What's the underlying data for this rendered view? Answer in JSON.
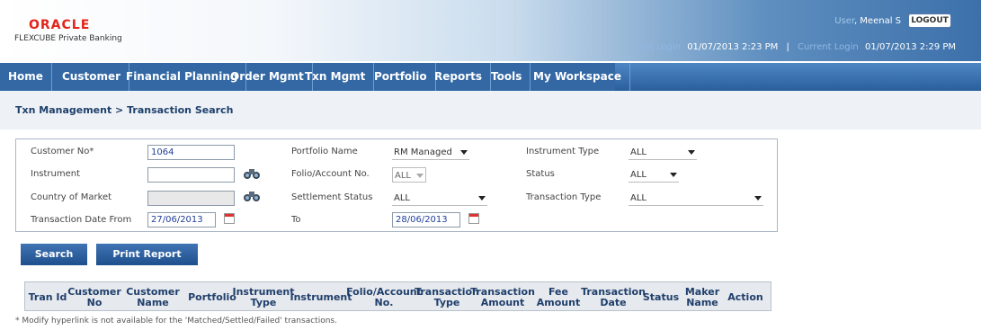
{
  "header": {
    "logo": "ORACLE",
    "product": "FLEXCUBE Private Banking",
    "user_label": "User",
    "user_name": ", Meenal S",
    "logout": "LOGOUT",
    "last_login_label": "Last Login",
    "last_login_value": "01/07/2013 2:23 PM",
    "current_login_label": "Current Login",
    "current_login_value": "01/07/2013 2:29 PM",
    "separator": "|"
  },
  "nav": [
    "Home",
    "Customer",
    "Financial Planning",
    "Order Mgmt",
    "Txn Mgmt",
    "Portfolio",
    "Reports",
    "Tools",
    "My Workspace"
  ],
  "breadcrumb": "Txn Management > Transaction Search",
  "form": {
    "customer_no_label": "Customer No*",
    "customer_no_value": "1064",
    "instrument_label": "Instrument",
    "instrument_value": "",
    "country_label": "Country of Market",
    "country_value": "",
    "date_from_label": "Transaction Date From",
    "date_from_value": "27/06/2013",
    "portfolio_name_label": "Portfolio Name",
    "portfolio_name_value": "RM Managed",
    "folio_label": "Folio/Account No.",
    "folio_value": "ALL",
    "settlement_label": "Settlement Status",
    "settlement_value": "ALL",
    "to_label": "To",
    "to_value": "28/06/2013",
    "instrument_type_label": "Instrument Type",
    "instrument_type_value": "ALL",
    "status_label": "Status",
    "status_value": "ALL",
    "txn_type_label": "Transaction Type",
    "txn_type_value": "ALL"
  },
  "buttons": {
    "search": "Search",
    "print": "Print Report"
  },
  "table": {
    "columns": [
      [
        "Tran Id",
        ""
      ],
      [
        "Customer",
        "No"
      ],
      [
        "Customer",
        "Name"
      ],
      [
        "Portfolio",
        ""
      ],
      [
        "Instrument",
        "Type"
      ],
      [
        "Instrument",
        ""
      ],
      [
        "Folio/Account",
        "No."
      ],
      [
        "Transaction",
        "Type"
      ],
      [
        "Transaction",
        "Amount"
      ],
      [
        "Fee",
        "Amount"
      ],
      [
        "Transaction",
        "Date"
      ],
      [
        "Status",
        ""
      ],
      [
        "Maker",
        "Name"
      ],
      [
        "Action",
        ""
      ]
    ]
  },
  "note": "* Modify hyperlink is not available for the 'Matched/Settled/Failed' transactions."
}
